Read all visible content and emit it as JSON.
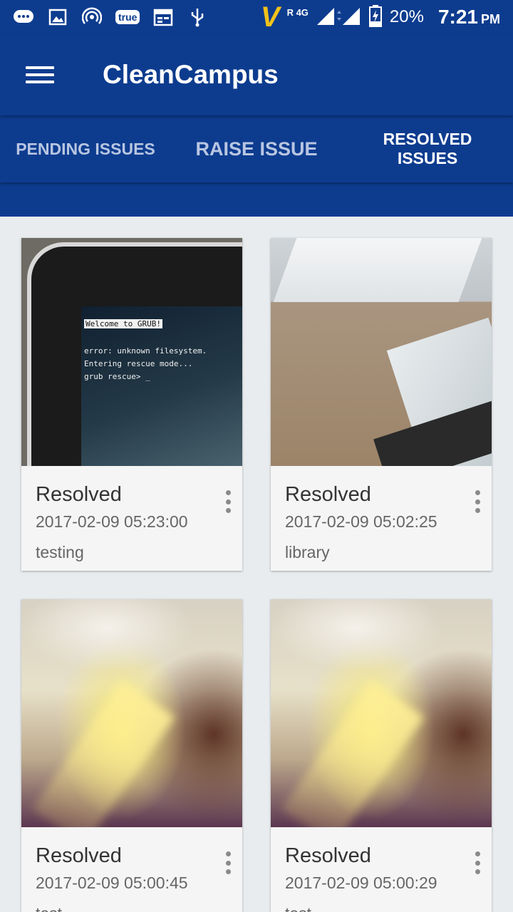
{
  "status_bar": {
    "carrier_chip": "true",
    "network": "R 4G",
    "battery": "20%",
    "time": "7:21",
    "ampm": "PM"
  },
  "app_bar": {
    "title": "CleanCampus"
  },
  "tabs": [
    {
      "label": "PENDING ISSUES",
      "selected": false
    },
    {
      "label": "RAISE ISSUE",
      "selected": false
    },
    {
      "label": "RESOLVED ISSUES",
      "selected": true
    }
  ],
  "grub_screen": {
    "line1": "Welcome to GRUB!",
    "line2": "error: unknown filesystem.",
    "line3": "Entering rescue mode...",
    "line4": "grub rescue> _"
  },
  "issues": [
    {
      "status": "Resolved",
      "date": "2017-02-09 05:23:00",
      "description": "testing"
    },
    {
      "status": "Resolved",
      "date": "2017-02-09 05:02:25",
      "description": "library"
    },
    {
      "status": "Resolved",
      "date": "2017-02-09 05:00:45",
      "description": "test"
    },
    {
      "status": "Resolved",
      "date": "2017-02-09 05:00:29",
      "description": "test"
    }
  ],
  "colors": {
    "primary": "#0d3c8f",
    "background": "#e8ecef",
    "card": "#f5f5f5",
    "tab_inactive": "#b8c6e2"
  }
}
